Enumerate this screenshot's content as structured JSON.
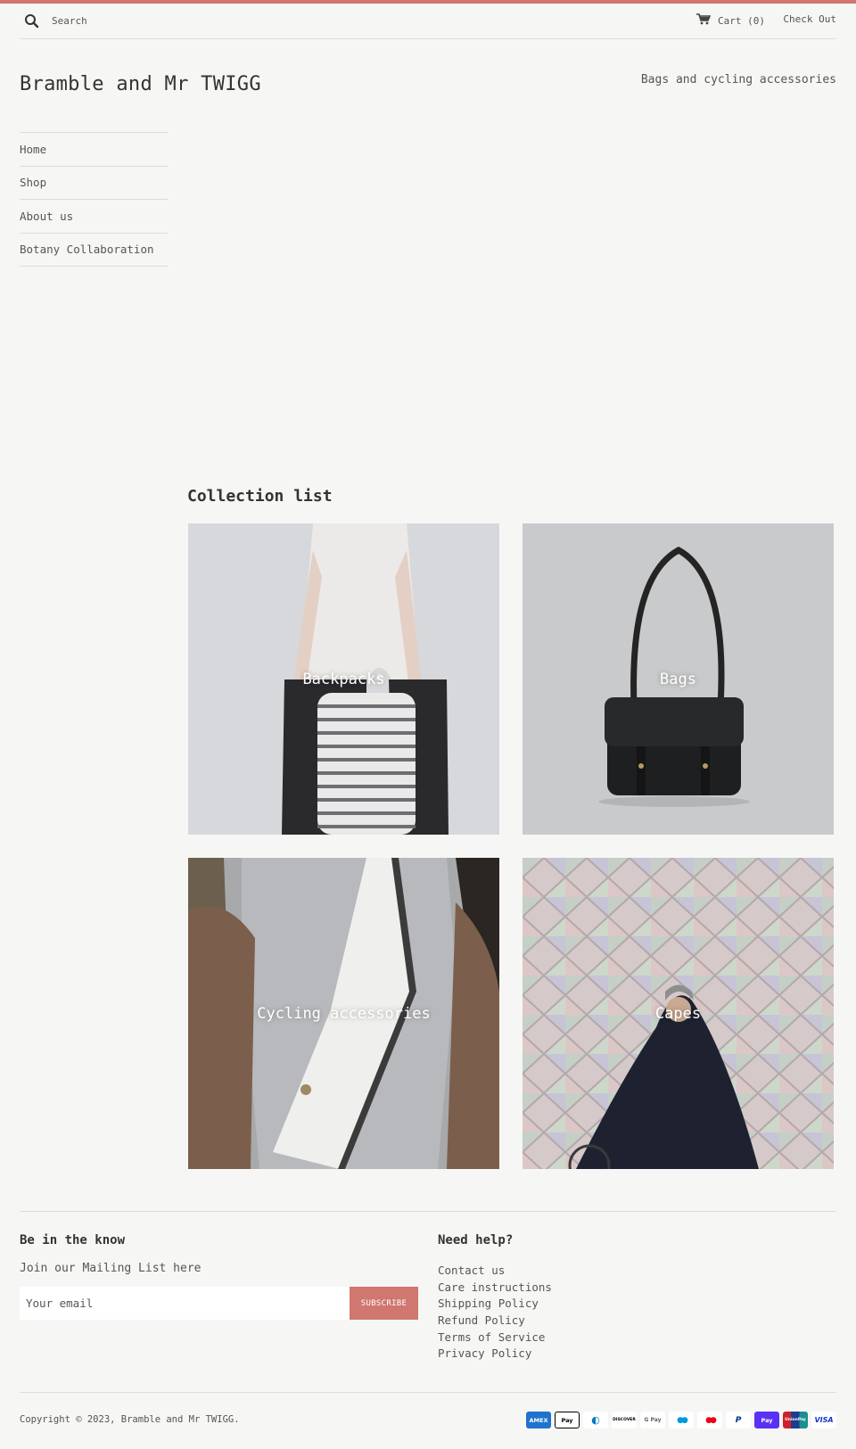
{
  "header": {
    "search_placeholder": "Search",
    "cart_label": "Cart (0)",
    "checkout_label": "Check Out"
  },
  "brand": {
    "title": "Bramble and Mr TWIGG",
    "tagline": "Bags and cycling accessories",
    "accent_color": "#d0776f"
  },
  "nav": {
    "items": [
      {
        "label": "Home"
      },
      {
        "label": "Shop"
      },
      {
        "label": "About us"
      },
      {
        "label": "Botany Collaboration"
      }
    ]
  },
  "collections": {
    "heading": "Collection list",
    "items": [
      {
        "label": "Backpacks"
      },
      {
        "label": "Bags"
      },
      {
        "label": "Cycling accessories"
      },
      {
        "label": "Capes"
      }
    ]
  },
  "footer": {
    "newsletter_heading": "Be in the know",
    "newsletter_text": "Join our Mailing List here",
    "email_placeholder": "Your email",
    "subscribe_label": "SUBSCRIBE",
    "help_heading": "Need help?",
    "help_links": [
      {
        "label": "Contact us"
      },
      {
        "label": "Care instructions"
      },
      {
        "label": "Shipping Policy"
      },
      {
        "label": "Refund Policy"
      },
      {
        "label": "Terms of Service"
      },
      {
        "label": "Privacy Policy"
      }
    ],
    "copyright": "Copyright © 2023, Bramble and Mr TWIGG.",
    "payment_icons": [
      {
        "name": "amex-icon",
        "label": "AMEX",
        "bg": "#1f72cd",
        "fg": "#ffffff"
      },
      {
        "name": "apple-pay-icon",
        "label": "Pay",
        "bg": "#ffffff",
        "fg": "#000000"
      },
      {
        "name": "diners-club-icon",
        "label": "◐",
        "bg": "#ffffff",
        "fg": "#0079be"
      },
      {
        "name": "discover-icon",
        "label": "DISCOVER",
        "bg": "#ffffff",
        "fg": "#000000"
      },
      {
        "name": "google-pay-icon",
        "label": "G Pay",
        "bg": "#ffffff",
        "fg": "#5f6368"
      },
      {
        "name": "maestro-icon",
        "label": "●●",
        "bg": "#ffffff",
        "fg": "#0099df"
      },
      {
        "name": "mastercard-icon",
        "label": "●●",
        "bg": "#ffffff",
        "fg": "#eb001b"
      },
      {
        "name": "paypal-icon",
        "label": "P",
        "bg": "#ffffff",
        "fg": "#003087"
      },
      {
        "name": "shop-pay-icon",
        "label": "Pay",
        "bg": "#5a31f4",
        "fg": "#ffffff"
      },
      {
        "name": "union-pay-icon",
        "label": "UnionPay",
        "bg": "#1a8f8f",
        "fg": "#ffffff"
      },
      {
        "name": "visa-icon",
        "label": "VISA",
        "bg": "#ffffff",
        "fg": "#1434cb"
      }
    ]
  }
}
